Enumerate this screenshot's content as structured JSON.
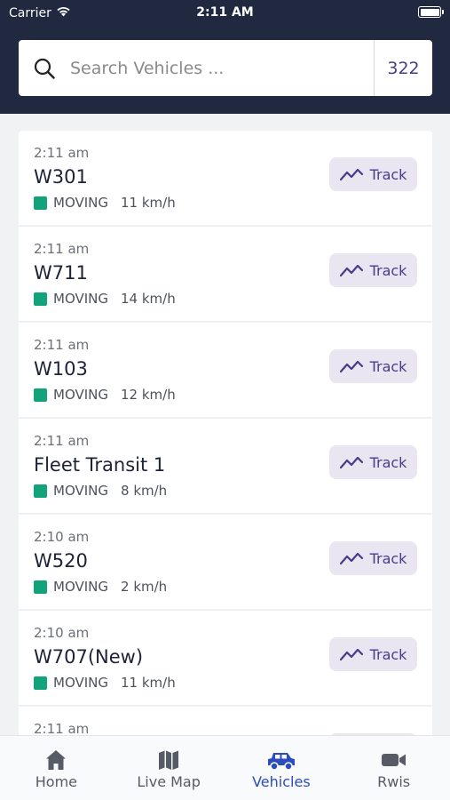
{
  "status_bar": {
    "carrier": "Carrier",
    "time": "2:11 AM"
  },
  "search": {
    "placeholder": "Search Vehicles ...",
    "count": "322"
  },
  "vehicles": [
    {
      "time": "2:11 am",
      "name": "W301",
      "status": "MOVING",
      "speed": "11 km/h",
      "action": "Track"
    },
    {
      "time": "2:11 am",
      "name": "W711",
      "status": "MOVING",
      "speed": "14 km/h",
      "action": "Track"
    },
    {
      "time": "2:11 am",
      "name": "W103",
      "status": "MOVING",
      "speed": "12 km/h",
      "action": "Track"
    },
    {
      "time": "2:11 am",
      "name": "Fleet Transit 1",
      "status": "MOVING",
      "speed": "8 km/h",
      "action": "Track"
    },
    {
      "time": "2:10 am",
      "name": "W520",
      "status": "MOVING",
      "speed": "2 km/h",
      "action": "Track"
    },
    {
      "time": "2:10 am",
      "name": "W707(New)",
      "status": "MOVING",
      "speed": "11 km/h",
      "action": "Track"
    },
    {
      "time": "2:11 am",
      "name": "",
      "status": "",
      "speed": "",
      "action": ""
    }
  ],
  "tabs": [
    {
      "label": "Home",
      "icon": "home-icon"
    },
    {
      "label": "Live Map",
      "icon": "map-icon"
    },
    {
      "label": "Vehicles",
      "icon": "truck-icon",
      "active": true
    },
    {
      "label": "Rwis",
      "icon": "video-camera-icon"
    }
  ],
  "colors": {
    "header": "#20293f",
    "accent": "#4a3b8a",
    "moving": "#12a37a",
    "active_tab": "#2c4bbd",
    "track_button_bg": "#e9e6f2"
  }
}
